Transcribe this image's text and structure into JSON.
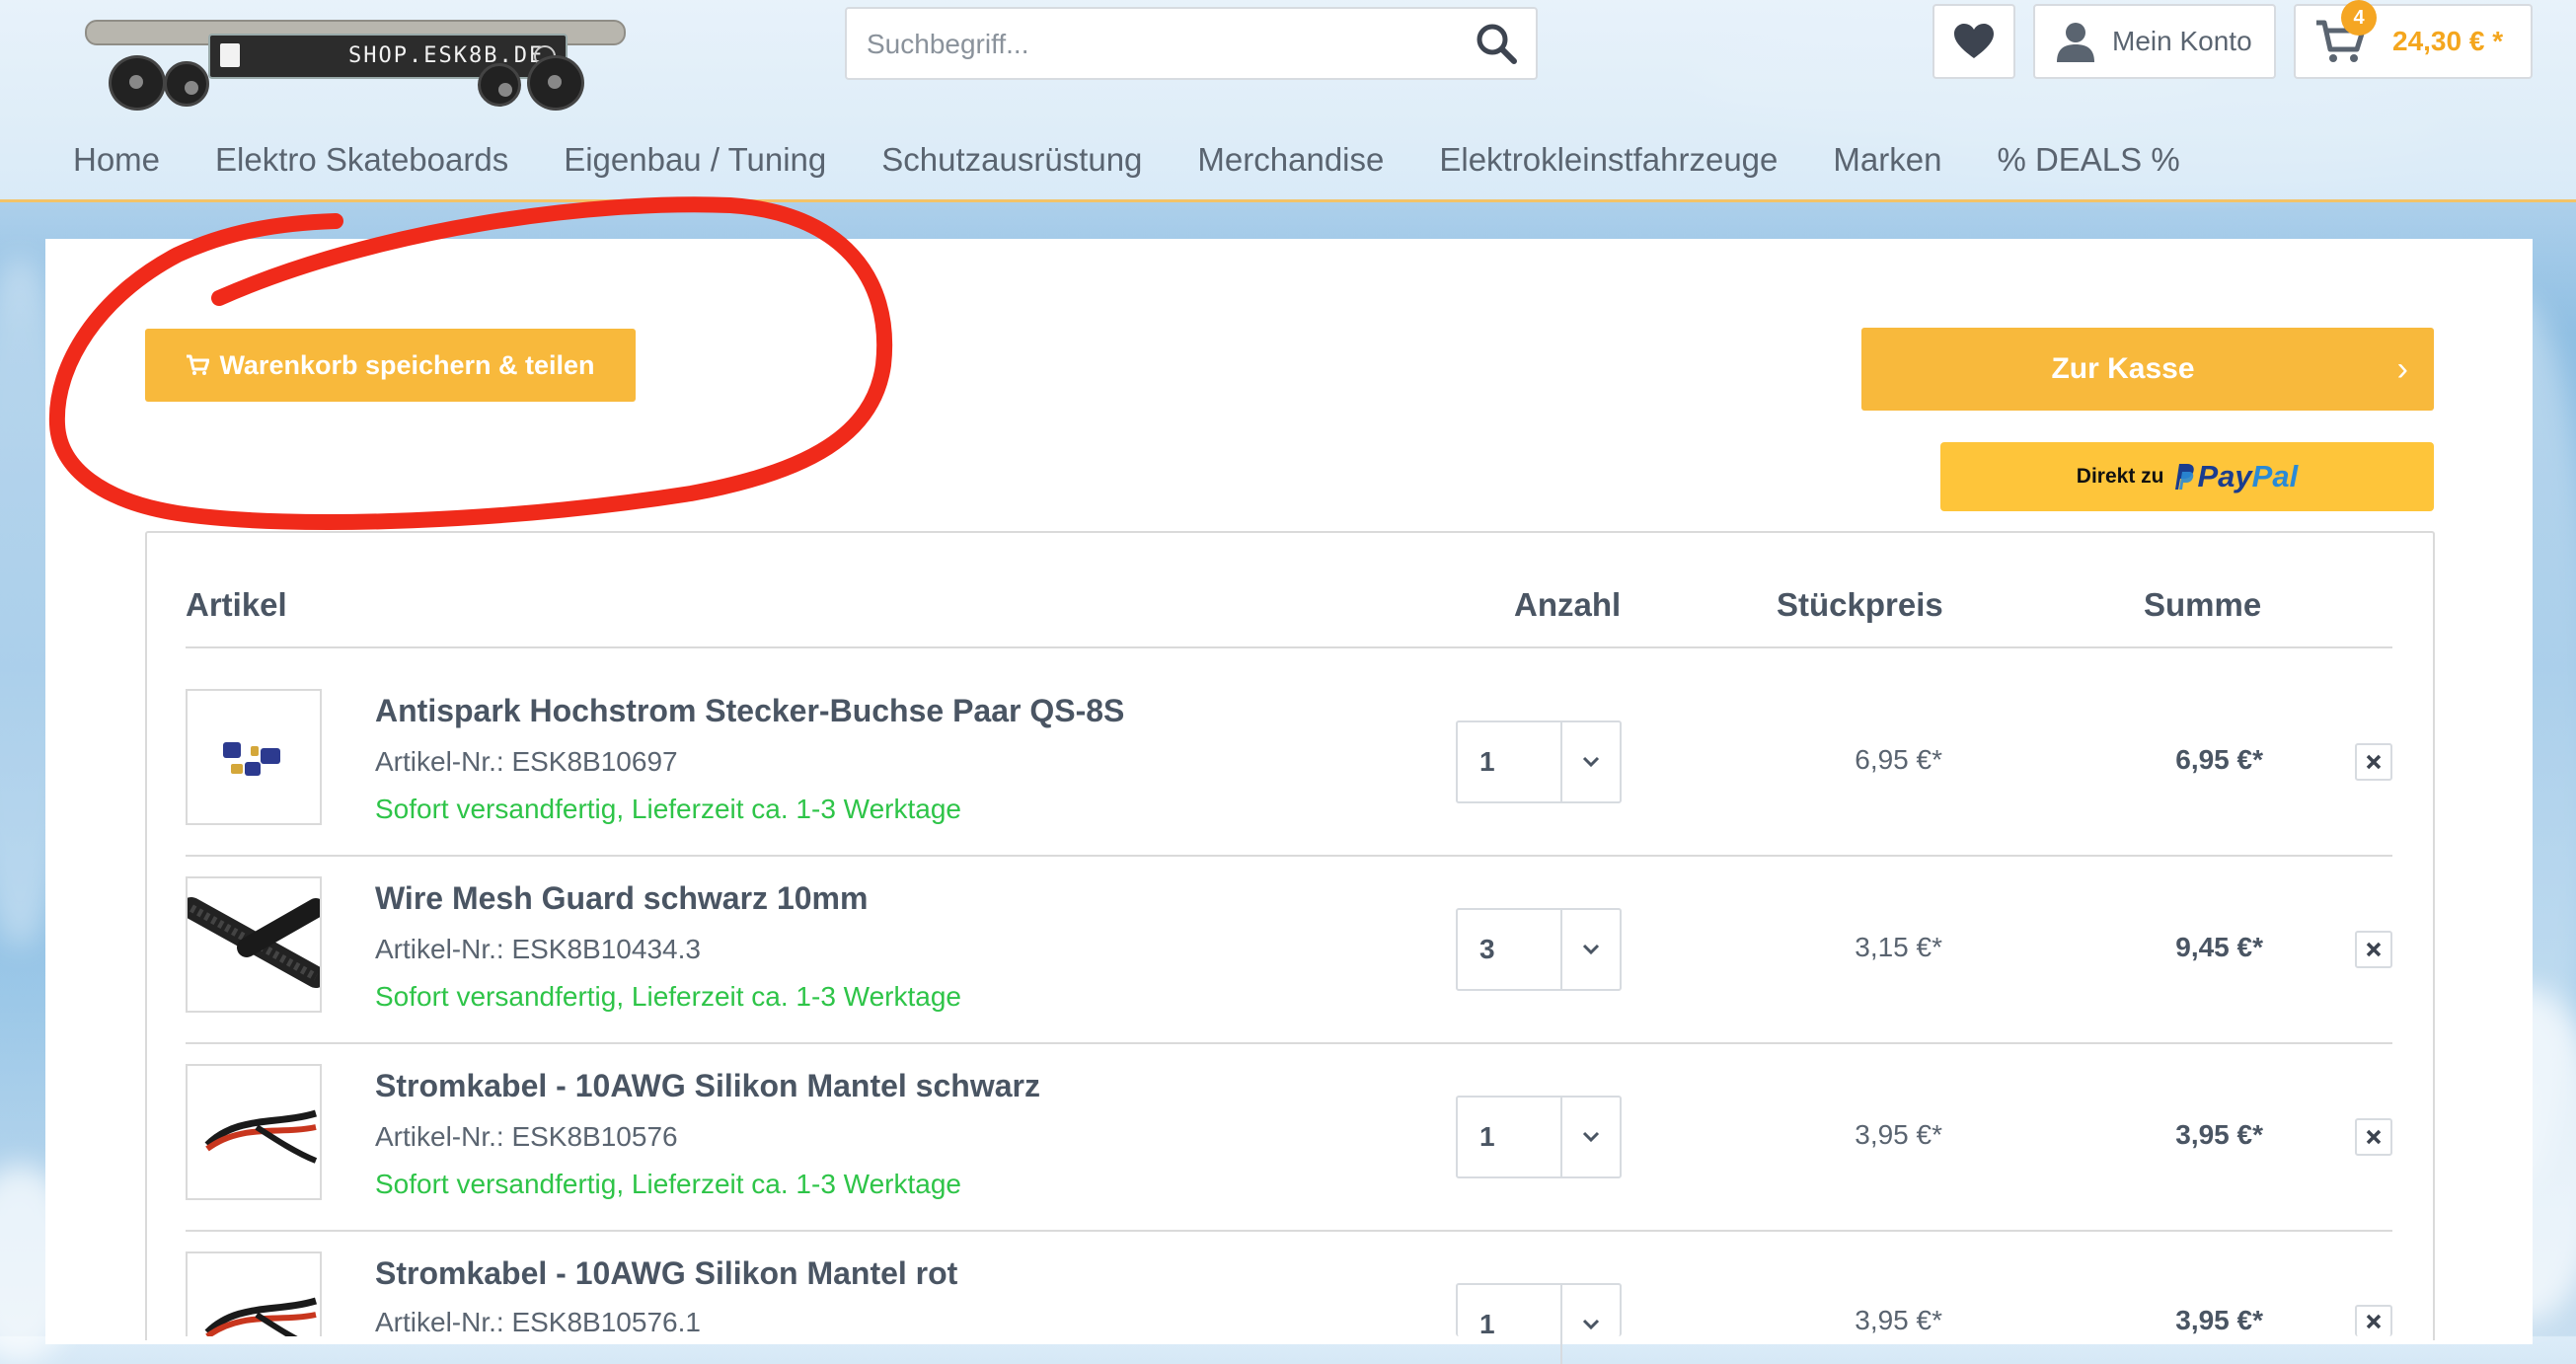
{
  "header": {
    "logo_text": "SHOP.ESK8B.DE",
    "search": {
      "placeholder": "Suchbegriff...",
      "icon": "search-icon"
    },
    "wishlist_icon": "heart-icon",
    "account": {
      "label": "Mein Konto",
      "icon": "user-icon"
    },
    "cart": {
      "badge": "4",
      "amount": "24,30 € *",
      "icon": "cart-icon"
    },
    "accent_color": "#f8b93c"
  },
  "nav": {
    "items": [
      {
        "label": "Home"
      },
      {
        "label": "Elektro Skateboards"
      },
      {
        "label": "Eigenbau / Tuning"
      },
      {
        "label": "Schutzausrüstung"
      },
      {
        "label": "Merchandise"
      },
      {
        "label": "Elektrokleinstfahrzeuge"
      },
      {
        "label": "Marken"
      },
      {
        "label": "% DEALS %"
      }
    ]
  },
  "actions": {
    "save_share_label": "Warenkorb speichern & teilen",
    "checkout_label": "Zur Kasse",
    "paypal_prefix": "Direkt zu",
    "paypal_pay": "Pay",
    "paypal_pal": "Pal"
  },
  "table": {
    "headers": {
      "article": "Artikel",
      "quantity": "Anzahl",
      "unit_price": "Stückpreis",
      "sum": "Summe"
    },
    "rows": [
      {
        "title": "Antispark Hochstrom Stecker-Buchse Paar QS-8S",
        "sku": "Artikel-Nr.: ESK8B10697",
        "stock": "Sofort versandfertig, Lieferzeit ca. 1-3 Werktage",
        "qty": "1",
        "unit": "6,95 €*",
        "total": "6,95 €*"
      },
      {
        "title": "Wire Mesh Guard schwarz 10mm",
        "sku": "Artikel-Nr.: ESK8B10434.3",
        "stock": "Sofort versandfertig, Lieferzeit ca. 1-3 Werktage",
        "qty": "3",
        "unit": "3,15 €*",
        "total": "9,45 €*"
      },
      {
        "title": "Stromkabel - 10AWG Silikon Mantel schwarz",
        "sku": "Artikel-Nr.: ESK8B10576",
        "stock": "Sofort versandfertig, Lieferzeit ca. 1-3 Werktage",
        "qty": "1",
        "unit": "3,95 €*",
        "total": "3,95 €*"
      },
      {
        "title": "Stromkabel - 10AWG Silikon Mantel rot",
        "sku": "Artikel-Nr.: ESK8B10576.1",
        "stock": "",
        "qty": "1",
        "unit": "3,95 €*",
        "total": "3,95 €*"
      }
    ]
  },
  "colors": {
    "stock_green": "#2ec448",
    "annotation_red": "#f02a1a",
    "paypal_yellow": "#fec53a"
  }
}
